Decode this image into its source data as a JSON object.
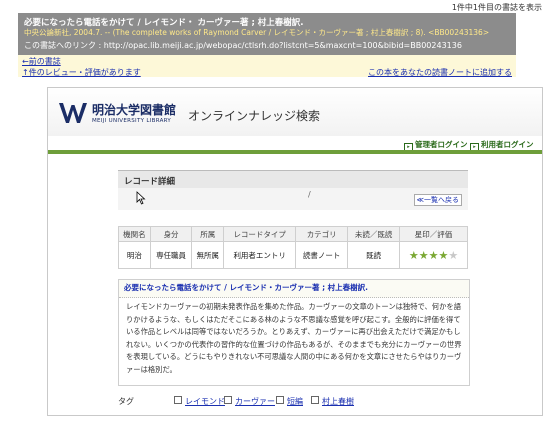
{
  "counter": "1件中1件目の書誌を表示",
  "info": {
    "title": "必要になったら電話をかけて / レイモンド・ カーヴァー著 ; 村上春樹訳.",
    "publisher": "中央公論新社, 2004.7. -- (The complete works of Raymond Carver / レイモンド・カーヴァー著 ; 村上春樹訳 ; 8). <BB00243136>",
    "permalink": "この書誌へのリンク : http://opac.lib.meiji.ac.jp/webopac/ctlsrh.do?listcnt=5&maxcnt=100&bibid=BB00243136"
  },
  "links": {
    "prev": "←前の書誌",
    "review": "↑件のレビュー・評価があります",
    "notebook": "この本をあなたの読書ノートに追加する"
  },
  "header": {
    "library_name": "明治大学図書館",
    "library_name_en": "MEIJI UNIVERSITY LIBRARY",
    "site_title": "オンラインナレッジ検索",
    "admin_login": "管理者ログイン",
    "user_login": "利用者ログイン"
  },
  "record": {
    "heading": "レコード詳細",
    "slash": "/",
    "back_to_list": "≪一覧へ戻る",
    "columns": [
      "機関名",
      "身分",
      "所属",
      "レコードタイプ",
      "カテゴリ",
      "未読／既読",
      "星印／評価"
    ],
    "row": [
      "明治",
      "専任職員",
      "無所属",
      "利用者エントリ",
      "読書ノート",
      "既読"
    ],
    "rating": 4,
    "rating_max": 5
  },
  "summary": {
    "title": "必要になったら電話をかけて / レイモンド・カーヴァー著 ; 村上春樹訳.",
    "text": "レイモンドカーヴァーの初期未発表作品を集めた作品。カーヴァーの文章のトーンは独特で、何かを語りかけるような、もしくはただそこにある林のような不思議な感覚を呼び起こす。全般的に評価を得ている作品とレベルは同等ではないだろうか。とりあえず、カーヴァーに再び出会えただけで満足かもしれない。いくつかの代表作の習作的な位置づけの作品もあるが、そのままでも充分にカーヴァーの世界を表現している。どうにもやりきれない不可思議な人間の中にある何かを文章にさせたらやはりカーヴァーは格別だ。"
  },
  "tags": {
    "label": "タグ",
    "items": [
      "レイモンド",
      "カーヴァー",
      "短編",
      "村上春樹"
    ]
  },
  "colors": {
    "accent_green": "#6e9e3a",
    "link_blue": "#1a2fb0",
    "info_gray": "#8c8c8c"
  }
}
